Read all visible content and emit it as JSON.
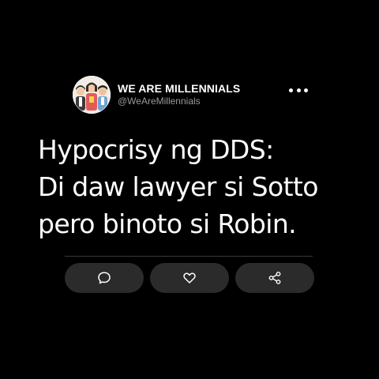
{
  "profile": {
    "display_name": "WE ARE MILLENNIALS",
    "handle": "@WeAreMillennials",
    "avatar_icon": "cartoon-group-avatar"
  },
  "menu": {
    "icon": "more-horizontal-icon"
  },
  "tweet": {
    "lines": [
      "Hypocrisy ng DDS:",
      "Di daw lawyer si Sotto",
      "pero binoto si Robin."
    ]
  },
  "actions": [
    {
      "name": "reply",
      "icon": "comment-icon"
    },
    {
      "name": "like",
      "icon": "heart-icon"
    },
    {
      "name": "share",
      "icon": "share-icon"
    }
  ],
  "colors": {
    "background": "#000000",
    "text": "#ffffff",
    "handle": "#9a9a9a",
    "button": "#2b2b2b",
    "divider": "#3a3a3a"
  }
}
